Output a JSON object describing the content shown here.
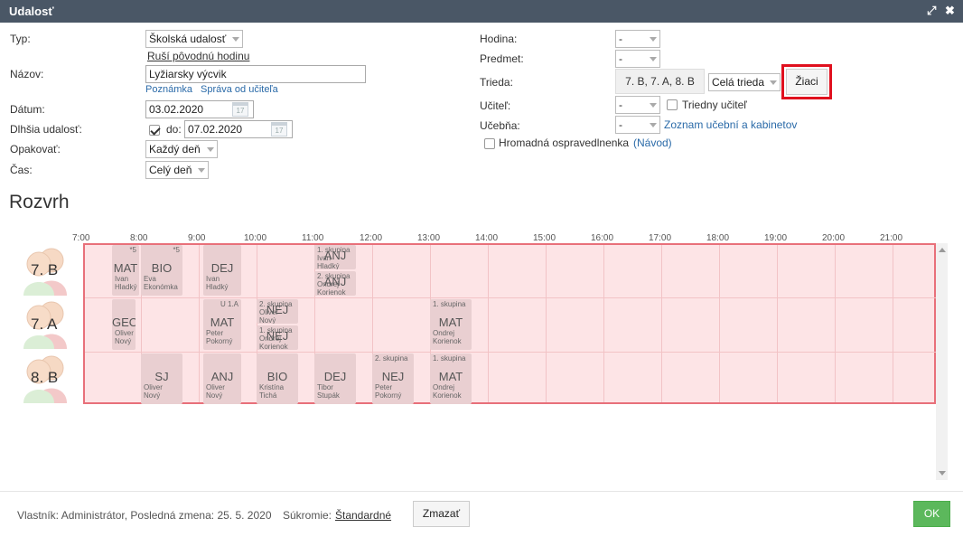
{
  "window": {
    "title": "Udalosť",
    "maximize_icon": "⤢",
    "close_icon": "✖"
  },
  "form": {
    "typ_label": "Typ:",
    "typ_value": "Školská udalosť",
    "rusi_link": "Ruší pôvodnú hodinu",
    "nazov_label": "Názov:",
    "nazov_value": "Lyžiarsky výcvik",
    "poznamka_link": "Poznámka",
    "sprava_link": "Správa od učiteľa",
    "datum_label": "Dátum:",
    "datum_value": "03.02.2020",
    "dlhsia_label": "Dlhšia udalosť:",
    "do_label": "do:",
    "do_value": "07.02.2020",
    "opakovat_label": "Opakovať:",
    "opakovat_value": "Každý deň",
    "cas_label": "Čas:",
    "cas_value": "Celý deň",
    "hodina_label": "Hodina:",
    "hodina_value": "-",
    "predmet_label": "Predmet:",
    "predmet_value": "-",
    "trieda_label": "Trieda:",
    "trieda_value": "7. B, 7. A, 8. B",
    "trieda_scope": "Celá trieda",
    "ziaci_button": "Žiaci",
    "ucitel_label": "Učiteľ:",
    "ucitel_value": "-",
    "triedny_label": "Triedny učiteľ",
    "ucebna_label": "Učebňa:",
    "ucebna_value": "-",
    "zoznam_link": "Zoznam učební a kabinetov",
    "hromadna_label": "Hromadná ospravedlnenka",
    "navod_link": "(Návod)"
  },
  "schedule": {
    "title": "Rozvrh",
    "hours": [
      "7:00",
      "8:00",
      "9:00",
      "10:00",
      "11:00",
      "12:00",
      "13:00",
      "14:00",
      "15:00",
      "16:00",
      "17:00",
      "18:00",
      "19:00",
      "20:00",
      "21:00"
    ],
    "rows": [
      "7. B",
      "7. A",
      "8. B"
    ],
    "lessons_7b": [
      {
        "subj": "MAT",
        "t1": "Ivan",
        "t2": "Hladký",
        "note": "*5",
        "grp": ""
      },
      {
        "subj": "BIO",
        "t1": "Eva",
        "t2": "Ekonómka",
        "note": "*5",
        "grp": ""
      },
      {
        "subj": "DEJ",
        "t1": "Ivan",
        "t2": "Hladký",
        "note": "",
        "grp": ""
      },
      {
        "subj": "ANJ",
        "t1": "Ivan",
        "t2": "Hladký",
        "note": "",
        "grp": "1. skupina"
      },
      {
        "subj": "ANJ",
        "t1": "Ondrej",
        "t2": "Korienok",
        "note": "",
        "grp": "2. skupina"
      }
    ],
    "lessons_7a": [
      {
        "subj": "GEO",
        "t1": "Oliver",
        "t2": "Nový",
        "note": "",
        "grp": ""
      },
      {
        "subj": "MAT",
        "t1": "Peter",
        "t2": "Pokorný",
        "note": "U 1.A",
        "grp": ""
      },
      {
        "subj": "NEJ",
        "t1": "Oliver",
        "t2": "Nový",
        "note": "",
        "grp": "2. skupina"
      },
      {
        "subj": "NEJ",
        "t1": "Ondrej",
        "t2": "Korienok",
        "note": "",
        "grp": "1. skupina"
      },
      {
        "subj": "MAT",
        "t1": "Ondrej",
        "t2": "Korienok",
        "note": "",
        "grp": "1. skupina"
      }
    ],
    "lessons_8b": [
      {
        "subj": "SJ",
        "t1": "Oliver",
        "t2": "Nový",
        "note": "",
        "grp": ""
      },
      {
        "subj": "ANJ",
        "t1": "Oliver",
        "t2": "Nový",
        "note": "",
        "grp": ""
      },
      {
        "subj": "BIO",
        "t1": "Kristína",
        "t2": "Tichá",
        "note": "",
        "grp": ""
      },
      {
        "subj": "DEJ",
        "t1": "Tibor",
        "t2": "Stupák",
        "note": "",
        "grp": ""
      },
      {
        "subj": "NEJ",
        "t1": "Peter",
        "t2": "Pokorný",
        "note": "",
        "grp": "2. skupina"
      },
      {
        "subj": "MAT",
        "t1": "Ondrej",
        "t2": "Korienok",
        "note": "",
        "grp": "1. skupina"
      }
    ]
  },
  "footer": {
    "owner": "Vlastník: Administrátor, Posledná zmena: 25. 5. 2020",
    "sukromie_label": "Súkromie:",
    "sukromie_value": "Štandardné",
    "delete_button": "Zmazať",
    "ok_button": "OK"
  }
}
